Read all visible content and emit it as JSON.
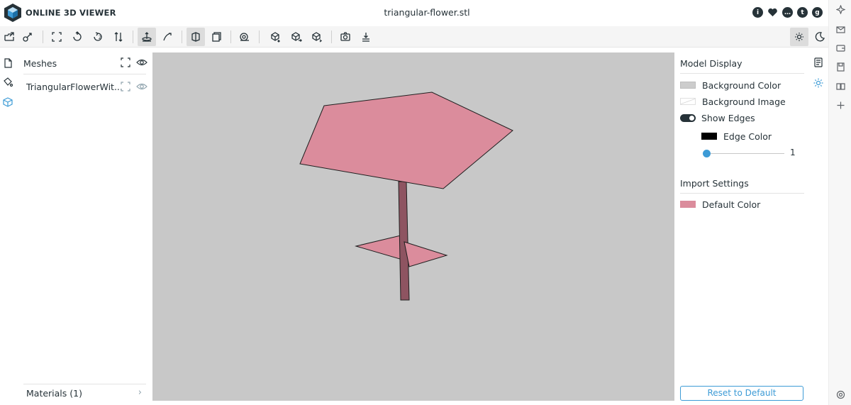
{
  "header": {
    "app_title": "ONLINE 3D VIEWER",
    "file_name": "triangular-flower.stl",
    "links": [
      "info-icon",
      "heart-icon",
      "chat-icon",
      "twitter-icon",
      "github-icon"
    ]
  },
  "toolbar": {
    "buttons": [
      "open-file-icon",
      "open-url-icon",
      "fit-to-window-icon",
      "set-up-vector-icon",
      "flip-up-vector-icon",
      "fix-up-vector-icon",
      "orbit-navigation-icon",
      "free-navigation-icon",
      "perspective-camera-icon",
      "orthographic-camera-icon",
      "measure-icon",
      "share-icon",
      "export-icon",
      "snapshot-icon",
      "embed-icon",
      "light-mode-icon",
      "dark-mode-icon"
    ]
  },
  "left_panel": {
    "meshes_title": "Meshes",
    "mesh_name": "TriangularFlowerWit...",
    "materials_label": "Materials (1)"
  },
  "right_panel": {
    "model_display_title": "Model Display",
    "background_color_label": "Background Color",
    "background_image_label": "Background Image",
    "show_edges_label": "Show Edges",
    "edge_color_label": "Edge Color",
    "edge_width_value": "1",
    "import_settings_title": "Import Settings",
    "default_color_label": "Default Color",
    "reset_label": "Reset to Default"
  },
  "colors": {
    "background_color": "#cccccc",
    "edge_color": "#000000",
    "default_color": "#db8c9c",
    "accent": "#3d9bd6"
  }
}
